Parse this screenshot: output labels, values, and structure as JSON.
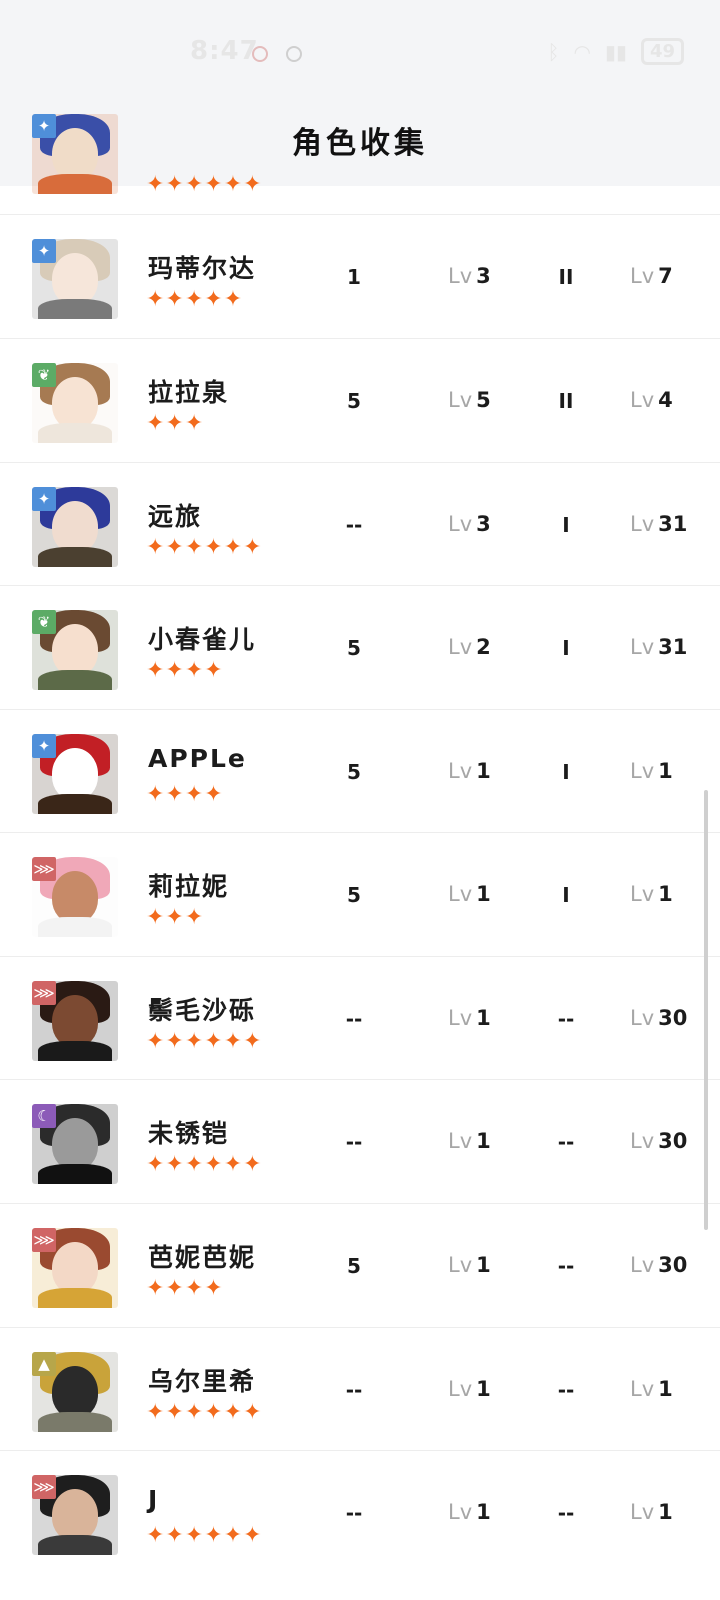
{
  "status_bar": {
    "time": "8:47",
    "battery": "49"
  },
  "header": {
    "title": "角色收集"
  },
  "characters": [
    {
      "name": "",
      "stars": 6,
      "col1": "",
      "lv1": "",
      "col2": "",
      "lv2": "",
      "element": "spark",
      "element_color": "#4f8fd9",
      "palette": [
        "#3a4fa8",
        "#f0dcc8",
        "#d86c3b"
      ]
    },
    {
      "name": "玛蒂尔达",
      "stars": 5,
      "col1": "1",
      "lv1": "3",
      "col2": "II",
      "lv2": "7",
      "element": "spark",
      "element_color": "#4f8fd9",
      "palette": [
        "#d8cbb8",
        "#f6e6da",
        "#7a7a7a"
      ]
    },
    {
      "name": "拉拉泉",
      "stars": 3,
      "col1": "5",
      "lv1": "5",
      "col2": "II",
      "lv2": "4",
      "element": "leaf",
      "element_color": "#5cab66",
      "palette": [
        "#a67a52",
        "#f7e3d3",
        "#eee6dc"
      ]
    },
    {
      "name": "远旅",
      "stars": 6,
      "col1": "--",
      "lv1": "3",
      "col2": "I",
      "lv2": "31",
      "element": "spark",
      "element_color": "#4f8fd9",
      "palette": [
        "#2d3a9a",
        "#f0dccf",
        "#4b4030"
      ]
    },
    {
      "name": "小春雀儿",
      "stars": 4,
      "col1": "5",
      "lv1": "2",
      "col2": "I",
      "lv2": "31",
      "element": "leaf",
      "element_color": "#5cab66",
      "palette": [
        "#6a4a32",
        "#f6dfce",
        "#5c6a48"
      ]
    },
    {
      "name": "APPLe",
      "stars": 4,
      "col1": "5",
      "lv1": "1",
      "col2": "I",
      "lv2": "1",
      "element": "spark",
      "element_color": "#4f8fd9",
      "palette": [
        "#c21f25",
        "#ffffff",
        "#3a2618"
      ]
    },
    {
      "name": "莉拉妮",
      "stars": 3,
      "col1": "5",
      "lv1": "1",
      "col2": "I",
      "lv2": "1",
      "element": "claw",
      "element_color": "#d06565",
      "palette": [
        "#f0a8b8",
        "#c78a68",
        "#f3f3f3"
      ]
    },
    {
      "name": "鬃毛沙砾",
      "stars": 6,
      "col1": "--",
      "lv1": "1",
      "col2": "--",
      "lv2": "30",
      "element": "claw",
      "element_color": "#d06565",
      "palette": [
        "#2a1a14",
        "#7c4a32",
        "#1a1a1a"
      ]
    },
    {
      "name": "未锈铠",
      "stars": 6,
      "col1": "--",
      "lv1": "1",
      "col2": "--",
      "lv2": "30",
      "element": "moon",
      "element_color": "#8c5bb8",
      "palette": [
        "#2b2b2b",
        "#9a9a9a",
        "#111111"
      ]
    },
    {
      "name": "芭妮芭妮",
      "stars": 4,
      "col1": "5",
      "lv1": "1",
      "col2": "--",
      "lv2": "30",
      "element": "claw",
      "element_color": "#d06565",
      "palette": [
        "#9a4a30",
        "#f3d8c6",
        "#d6a436"
      ]
    },
    {
      "name": "乌尔里希",
      "stars": 6,
      "col1": "--",
      "lv1": "1",
      "col2": "--",
      "lv2": "1",
      "element": "triangle",
      "element_color": "#b7a64a",
      "palette": [
        "#c9a33a",
        "#2a2a2a",
        "#7a7a6a"
      ]
    },
    {
      "name": "J",
      "stars": 6,
      "col1": "--",
      "lv1": "1",
      "col2": "--",
      "lv2": "1",
      "element": "claw",
      "element_color": "#d06565",
      "palette": [
        "#1e1e1e",
        "#d9b49a",
        "#3a3a3a"
      ]
    }
  ],
  "labels": {
    "lv_prefix": "Lv"
  }
}
